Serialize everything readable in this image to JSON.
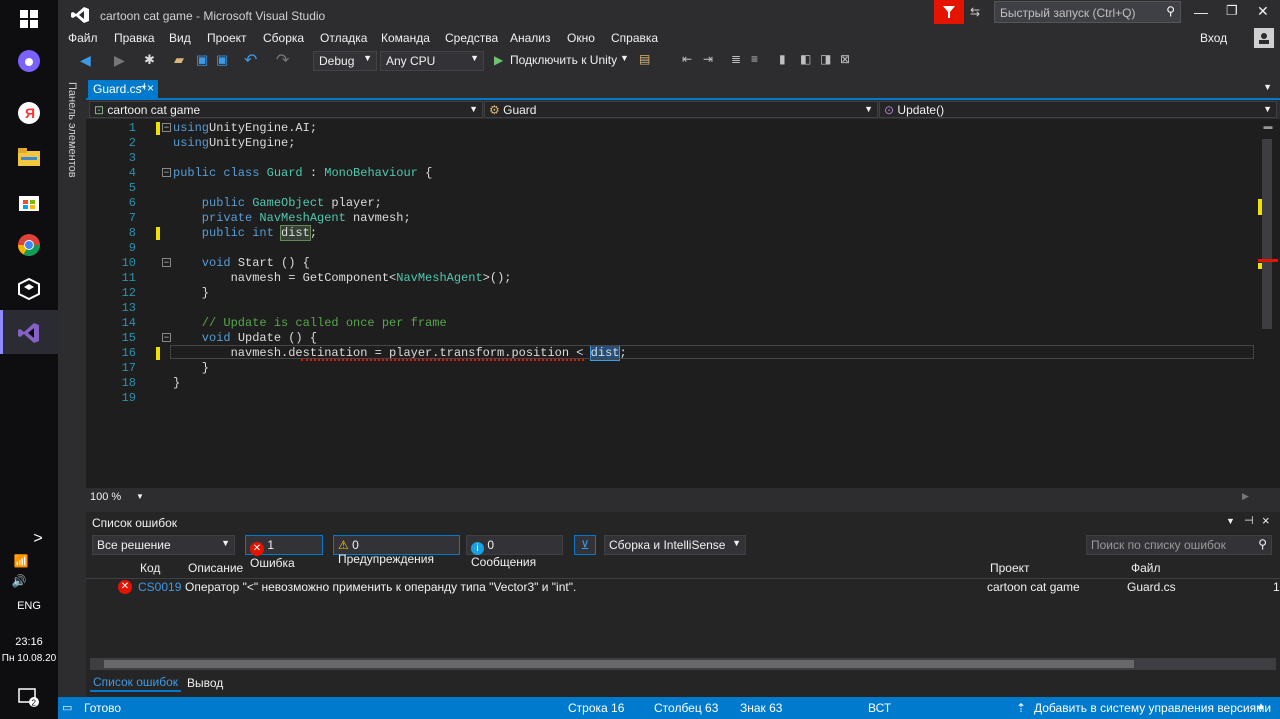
{
  "taskbar": {
    "time": "23:16",
    "date": "Пн 10.08.20",
    "lang": "ENG",
    "notif_count": "2"
  },
  "window": {
    "title": "cartoon cat game - Microsoft Visual Studio",
    "quick_launch_placeholder": "Быстрый запуск (Ctrl+Q)",
    "signin": "Вход"
  },
  "menu": [
    "Файл",
    "Правка",
    "Вид",
    "Проект",
    "Сборка",
    "Отладка",
    "Команда",
    "Средства",
    "Анализ",
    "Окно",
    "Справка"
  ],
  "toolbar": {
    "config": "Debug",
    "platform": "Any CPU",
    "run_label": "Подключить к Unity"
  },
  "side_panel_label": "Панель элементов",
  "tab": {
    "name": "Guard.cs*",
    "pin": "⊣",
    "close": "×"
  },
  "nav": {
    "project": "cartoon cat game",
    "class": "Guard",
    "member": "Update()"
  },
  "code_lines": [
    {
      "n": "1",
      "t": [
        [
          "kw",
          "using"
        ],
        [
          "",
          "UnityEngine.AI;"
        ]
      ]
    },
    {
      "n": "2",
      "t": [
        [
          "kw",
          "using"
        ],
        [
          "",
          "UnityEngine;"
        ]
      ]
    },
    {
      "n": "3",
      "t": []
    },
    {
      "n": "4",
      "t": [
        [
          "kw",
          "public class "
        ],
        [
          "ty",
          "Guard"
        ],
        [
          "",
          " : "
        ],
        [
          "ty",
          "MonoBehaviour"
        ],
        [
          "",
          " {"
        ]
      ]
    },
    {
      "n": "5",
      "t": []
    },
    {
      "n": "6",
      "t": [
        [
          "kw",
          "    public "
        ],
        [
          "ty",
          "GameObject"
        ],
        [
          "",
          " player;"
        ]
      ]
    },
    {
      "n": "7",
      "t": [
        [
          "kw",
          "    private "
        ],
        [
          "ty",
          "NavMeshAgent"
        ],
        [
          "",
          " navmesh;"
        ]
      ]
    },
    {
      "n": "8",
      "t": [
        [
          "kw",
          "    public int "
        ],
        [
          "hl",
          "dist"
        ],
        [
          "",
          ";"
        ]
      ]
    },
    {
      "n": "9",
      "t": []
    },
    {
      "n": "10",
      "t": [
        [
          "kw",
          "    void "
        ],
        [
          "",
          "Start () {"
        ]
      ]
    },
    {
      "n": "11",
      "t": [
        [
          "",
          "        navmesh = GetComponent<"
        ],
        [
          "ty",
          "NavMeshAgent"
        ],
        [
          "",
          ">();"
        ]
      ]
    },
    {
      "n": "12",
      "t": [
        [
          "",
          "    }"
        ]
      ]
    },
    {
      "n": "13",
      "t": []
    },
    {
      "n": "14",
      "t": [
        [
          "cm",
          "    // Update is called once per frame"
        ]
      ]
    },
    {
      "n": "15",
      "t": [
        [
          "kw",
          "    void "
        ],
        [
          "",
          "Update () {"
        ]
      ]
    },
    {
      "n": "16",
      "t": [
        [
          "",
          "        navmesh.destination = player.transform.position < "
        ],
        [
          "sel",
          "dist"
        ],
        [
          "",
          ";"
        ]
      ]
    },
    {
      "n": "17",
      "t": [
        [
          "",
          "    }"
        ]
      ]
    },
    {
      "n": "18",
      "t": [
        [
          "",
          "}"
        ]
      ]
    },
    {
      "n": "19",
      "t": []
    }
  ],
  "zoom": "100 %",
  "error_list": {
    "title": "Список ошибок",
    "scope": "Все решение",
    "errors_btn": "1 Ошибка",
    "warnings_btn": "0 Предупреждения",
    "messages_btn": "0 Сообщения",
    "build_filter": "Сборка и IntelliSense",
    "search_placeholder": "Поиск по списку ошибок",
    "columns": {
      "code": "Код",
      "description": "Описание",
      "project": "Проект",
      "file": "Файл"
    },
    "rows": [
      {
        "code": "CS0019",
        "description": "Оператор \"<\" невозможно применить к операнду типа \"Vector3\" и \"int\".",
        "project": "cartoon cat game",
        "file": "Guard.cs",
        "line": "1"
      }
    ],
    "tabs": [
      "Список ошибок",
      "Вывод"
    ]
  },
  "status": {
    "ready": "Готово",
    "line": "Строка 16",
    "col": "Столбец 63",
    "char": "Знак 63",
    "mode": "ВСТ",
    "vcs": "Добавить в систему управления версиями"
  },
  "colors": {
    "accent": "#007acc",
    "error": "#e51400",
    "background": "#1e1e1e"
  }
}
